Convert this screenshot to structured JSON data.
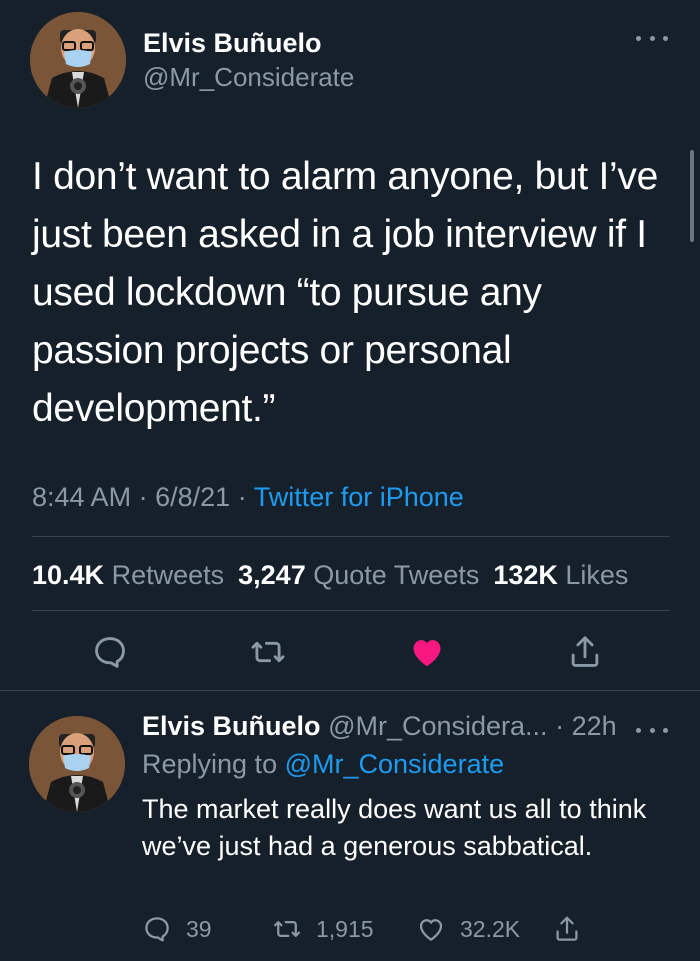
{
  "main_tweet": {
    "display_name": "Elvis Buñuelo",
    "handle": "@Mr_Considerate",
    "text": "I don’t want to alarm anyone, but I’ve just been asked in a job interview if I used lockdown “to pursue any passion projects or personal development.”",
    "time": "8:44 AM",
    "date": "6/8/21",
    "separator": "·",
    "source": "Twitter for iPhone",
    "stats": {
      "retweets_count": "10.4K",
      "retweets_label": "Retweets",
      "quotes_count": "3,247",
      "quotes_label": "Quote Tweets",
      "likes_count": "132K",
      "likes_label": "Likes"
    },
    "actions": {
      "reply_icon": "speech-bubble-icon",
      "retweet_icon": "retweet-icon",
      "like_icon": "heart-filled-icon",
      "share_icon": "share-icon"
    },
    "liked": true
  },
  "reply_tweet": {
    "display_name": "Elvis Buñuelo",
    "handle_truncated": "@Mr_Considera...",
    "separator": "·",
    "age": "22h",
    "replying_prefix": "Replying to",
    "replying_to": "@Mr_Considerate",
    "text": "The market really does want us all to think we’ve just had a generous sabbatical.",
    "reply_count": "39",
    "retweet_count": "1,915",
    "like_count": "32.2K"
  },
  "colors": {
    "background": "#15202b",
    "text": "#ffffff",
    "muted": "#8b98a5",
    "link": "#1d9bf0",
    "like": "#f91880",
    "divider": "#38444d"
  }
}
